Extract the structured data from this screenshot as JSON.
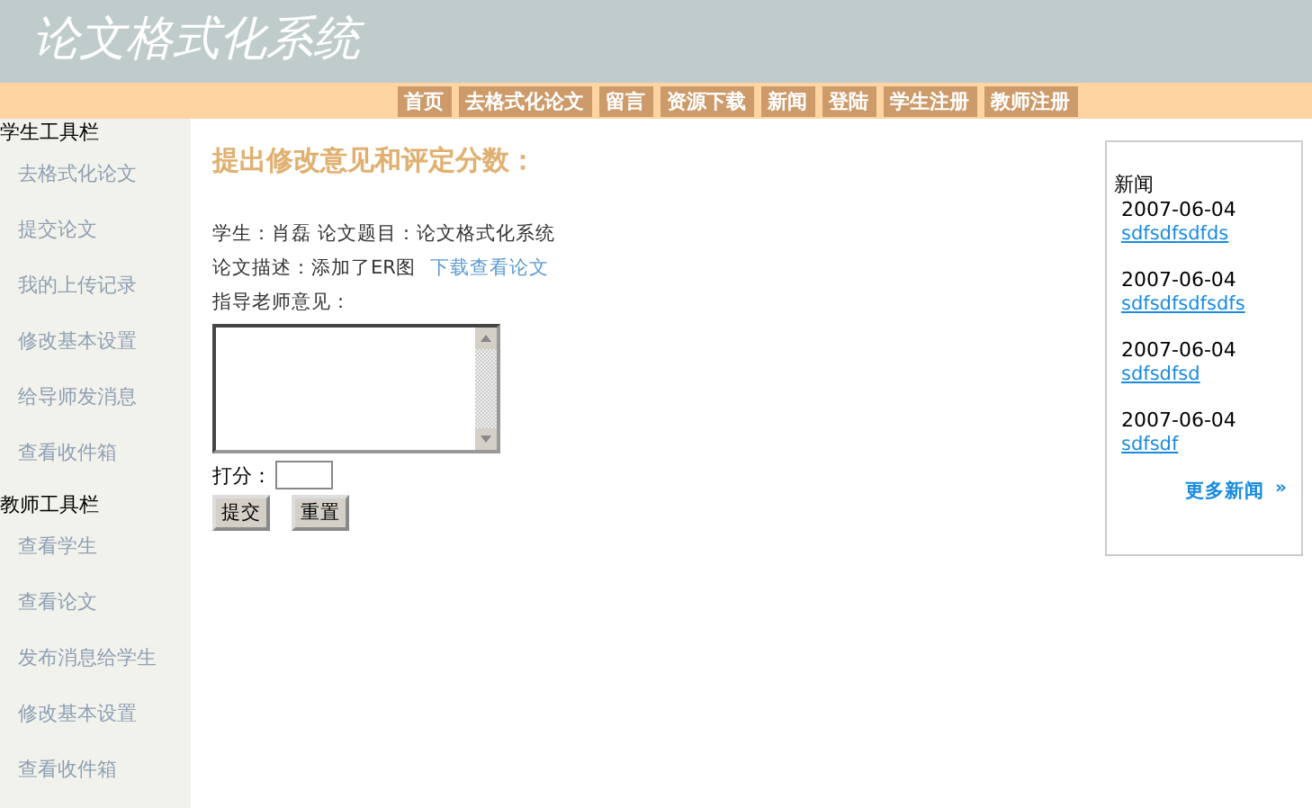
{
  "header": {
    "title": "论文格式化系统"
  },
  "nav": [
    "首页",
    "去格式化论文",
    "留言",
    "资源下载",
    "新闻",
    "登陆",
    "学生注册",
    "教师注册"
  ],
  "sidebar": [
    {
      "heading": "学生工具栏",
      "items": [
        "去格式化论文",
        "提交论文",
        "我的上传记录",
        "修改基本设置",
        "给导师发消息",
        "查看收件箱"
      ]
    },
    {
      "heading": "教师工具栏",
      "items": [
        "查看学生",
        "查看论文",
        "发布消息给学生",
        "修改基本设置",
        "查看收件箱"
      ]
    }
  ],
  "main": {
    "heading": "提出修改意见和评定分数：",
    "info": "学生：肖磊  论文题目：论文格式化系统",
    "description": "论文描述：添加了ER图",
    "download_link": "下载查看论文",
    "comment_label": "指导老师意见：",
    "score_label": "打分：",
    "buttons": [
      "提交",
      "重置"
    ]
  },
  "news": {
    "heading": "新闻",
    "items": [
      {
        "date": "2007-06-04",
        "title": "sdfsdfsdfds"
      },
      {
        "date": "2007-06-04",
        "title": "sdfsdfsdfsdfs"
      },
      {
        "date": "2007-06-04",
        "title": "sdfsdfsd"
      },
      {
        "date": "2007-06-04",
        "title": "sdfsdf"
      }
    ],
    "more": "更多新闻",
    "more_icon": "»"
  }
}
